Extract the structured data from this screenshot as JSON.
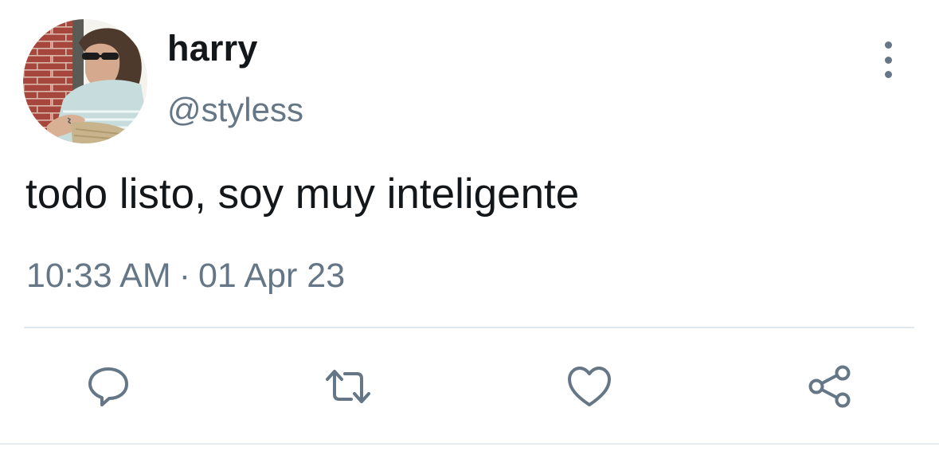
{
  "tweet": {
    "display_name": "harry",
    "handle": "@styless",
    "text": "todo listo, soy muy inteligente",
    "time": "10:33 AM",
    "separator": "·",
    "date": "01 Apr 23"
  },
  "icons": {
    "more": "more-vertical-icon",
    "reply": "reply-icon",
    "retweet": "retweet-icon",
    "like": "heart-icon",
    "share": "share-icon"
  },
  "colors": {
    "text_primary": "#14171a",
    "text_secondary": "#657786",
    "divider": "#e1e8ed"
  }
}
